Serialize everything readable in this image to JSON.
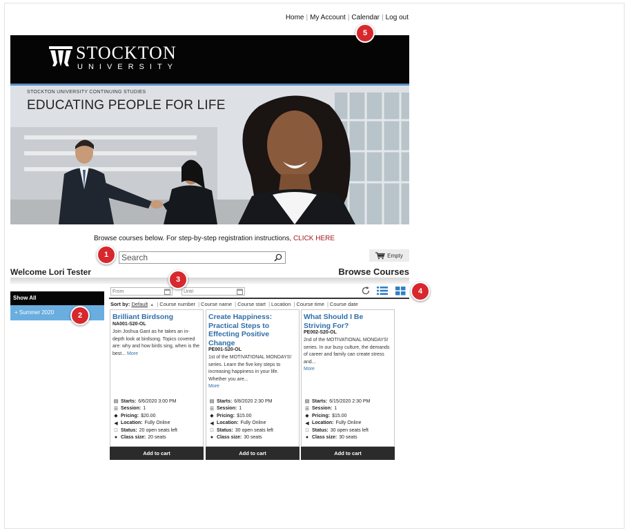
{
  "nav": {
    "links": [
      "Home",
      "My Account",
      "Calendar",
      "Log out"
    ]
  },
  "header": {
    "logo_name": "STOCKTON",
    "logo_sub": "UNIVERSITY",
    "hero_kicker": "STOCKTON UNIVERSITY CONTINUING STUDIES",
    "hero_title": "EDUCATING PEOPLE FOR LIFE"
  },
  "instructions": {
    "text": "Browse courses below. For step-by-step registration instructions, ",
    "link": "CLICK HERE"
  },
  "search": {
    "placeholder": "Search",
    "icon": "search-icon"
  },
  "cart": {
    "label": "Empty",
    "icon": "cart-icon"
  },
  "welcome": "Welcome Lori Tester",
  "browse_title": "Browse Courses",
  "sidebar": {
    "head": "Show All",
    "items": [
      {
        "label": "+ Summer 2020"
      }
    ]
  },
  "filters": {
    "from_placeholder": "From",
    "until_placeholder": "Until"
  },
  "sort": {
    "label": "Sort by:",
    "default": "Default",
    "arrow": "▲",
    "options": [
      "Course number",
      "Course name",
      "Course start",
      "Location",
      "Course time",
      "Course date"
    ]
  },
  "cards": [
    {
      "title": "Brilliant Birdsong",
      "code": "NA001-S20-OL",
      "description": "Join Joshua Gant as he takes an in-depth look at birdsong. Topics covered are: why and how birds sing, when is the best...",
      "more": "More",
      "starts": "6/6/2020 3:00 PM",
      "session": "1",
      "pricing": "$20.00",
      "location": "Fully Online",
      "status": "20 open seats left",
      "class_size": "20 seats",
      "button": "Add to cart"
    },
    {
      "title": "Create Happiness: Practical Steps to Effecting Positive Change",
      "code": "PE001-S20-OL",
      "description": "1st of the MOTIVATIONAL MONDAYS! series. Learn the five key steps to increasing happiness in your life. Whether you are...",
      "more": "More",
      "starts": "6/8/2020 2:30 PM",
      "session": "1",
      "pricing": "$15.00",
      "location": "Fully Online",
      "status": "30 open seats left",
      "class_size": "30 seats",
      "button": "Add to cart"
    },
    {
      "title": "What Should I Be Striving For?",
      "code": "PE002-S20-OL",
      "description": "2nd of the MOTIVATIONAL MONDAYS! series. In our busy culture, the demands of career and family can create stress and...",
      "more": "More",
      "starts": "6/15/2020 2:30 PM",
      "session": "1",
      "pricing": "$15.00",
      "location": "Fully Online",
      "status": "30 open seats left",
      "class_size": "30 seats",
      "button": "Add to cart"
    }
  ],
  "meta_labels": {
    "starts": "Starts:",
    "session": "Session:",
    "pricing": "Pricing:",
    "location": "Location:",
    "status": "Status:",
    "class_size": "Class size:"
  },
  "callouts": [
    "1",
    "2",
    "3",
    "4",
    "5"
  ],
  "colors": {
    "header_bg": "#050505",
    "accent_blue": "#6aaee0",
    "link_blue": "#2f6ea8",
    "click_here_red": "#a11a1a",
    "callout_red": "#d7282d",
    "button_dark": "#2b2b2b"
  }
}
